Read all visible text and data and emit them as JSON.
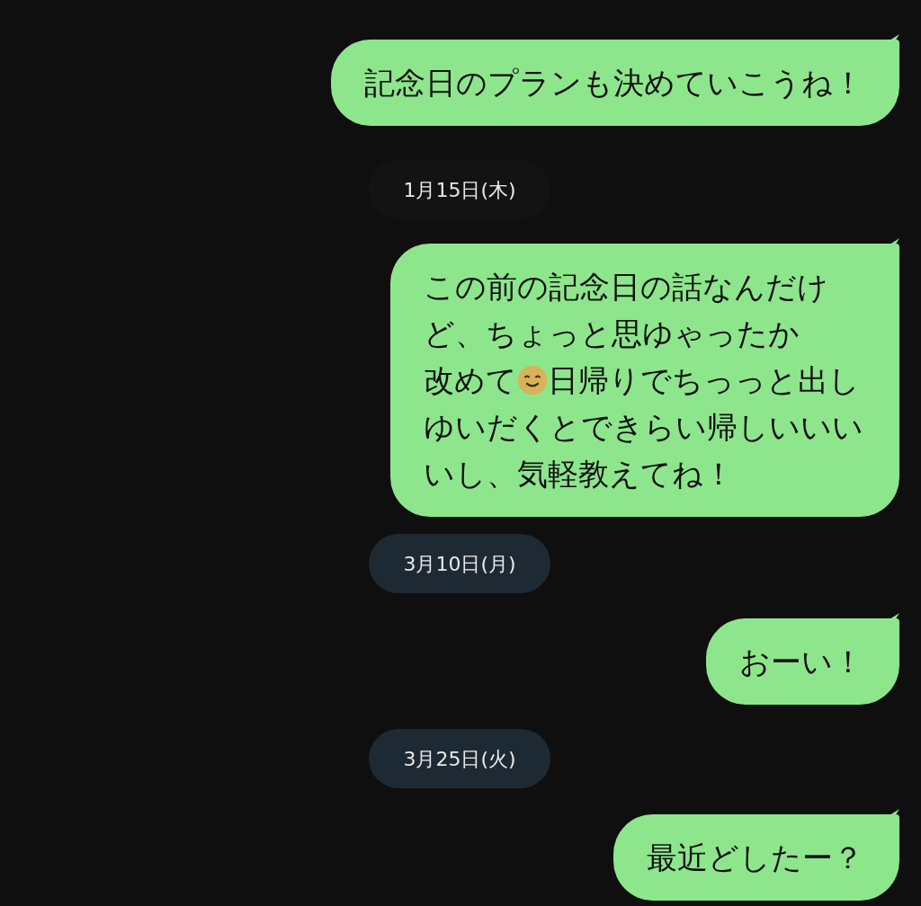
{
  "messages": [
    {
      "kind": "bubble",
      "lines": [
        [
          {
            "kind": "text",
            "text": "記念日のプランも決めていこうね！"
          }
        ]
      ]
    },
    {
      "kind": "date",
      "text": "1月15日(木)",
      "color": "#131313"
    },
    {
      "kind": "bubble",
      "lines": [
        [
          {
            "kind": "text",
            "text": "この前の記念日の話なんだけ"
          }
        ],
        [
          {
            "kind": "text",
            "text": "ど、ちょっと思ゆゃったか"
          }
        ],
        [
          {
            "kind": "text",
            "text": "改めて"
          },
          {
            "kind": "emoji"
          },
          {
            "kind": "text",
            "text": "日帰りでちっっと出し"
          }
        ],
        [
          {
            "kind": "text",
            "text": "ゆいだくとできらい帰しいいい"
          }
        ],
        [
          {
            "kind": "text",
            "text": "いし、気軽教えてね！"
          }
        ]
      ]
    },
    {
      "kind": "date",
      "text": "3月10日(月)",
      "color": "#1e2a33"
    },
    {
      "kind": "bubble",
      "lines": [
        [
          {
            "kind": "text",
            "text": "おーい！"
          }
        ]
      ]
    },
    {
      "kind": "date",
      "text": "3月25日(火)",
      "color": "#1e2a33"
    },
    {
      "kind": "bubble",
      "lines": [
        [
          {
            "kind": "text",
            "text": "最近どしたー？"
          }
        ]
      ]
    }
  ]
}
